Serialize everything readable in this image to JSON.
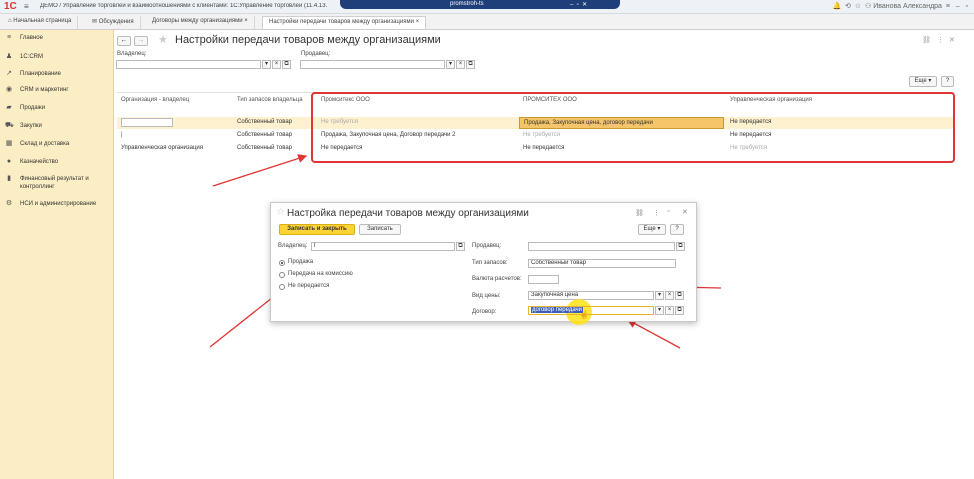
{
  "titlebar": {
    "logo": "1С",
    "title": "ДЕМО / Управление торговлей и взаимоотношениями с клиентами: 1С:Управление торговлей (11.4.13.",
    "overlay_text": "promstroh-ts",
    "user": "Иванова Александра"
  },
  "tabs": [
    {
      "label": "Начальная страница"
    },
    {
      "label": "Обсуждения"
    },
    {
      "label": "Договоры между организациями ×"
    },
    {
      "label": "Настройки передачи товаров между организациями ×"
    }
  ],
  "sidebar": {
    "items": [
      {
        "label": "Главное",
        "icon": "menu-icon"
      },
      {
        "label": "1С:CRM",
        "icon": "users-icon"
      },
      {
        "label": "Планирование",
        "icon": "chart-icon"
      },
      {
        "label": "CRM и маркетинг",
        "icon": "target-icon"
      },
      {
        "label": "Продажи",
        "icon": "bag-icon"
      },
      {
        "label": "Закупки",
        "icon": "cart-icon"
      },
      {
        "label": "Склад и доставка",
        "icon": "warehouse-icon"
      },
      {
        "label": "Казначейство",
        "icon": "coin-icon"
      },
      {
        "label": "Финансовый результат и контроллинг",
        "icon": "bar-chart-icon"
      },
      {
        "label": "НСИ и администрирование",
        "icon": "gear-icon"
      }
    ]
  },
  "page": {
    "title": "Настройки передачи товаров между организациями",
    "owner_label": "Владелец:",
    "owner_value": "",
    "seller_label": "Продавец:",
    "seller_value": "",
    "more_button": "Еще",
    "help_button": "?"
  },
  "grid": {
    "columns": [
      "Организация - владелец",
      "Тип запасов владельца",
      "Промситекс ООО",
      "ПРОМСИТЕХ ООО",
      "Управленческая организация"
    ],
    "rows": [
      [
        "",
        "Собственный товар",
        "Не требуется",
        "Продажа, Закупочная цена, договор передачи",
        "Не передается"
      ],
      [
        "",
        "Собственный товар",
        "Продажа, Закупочная цена, Договор передачи 2",
        "Не требуется",
        "Не передается"
      ],
      [
        "Управленческая организация",
        "Собственный товар",
        "Не передается",
        "Не передается",
        "Не требуется"
      ]
    ]
  },
  "dialog": {
    "title": "Настройка передачи товаров между организациями",
    "save_close_button": "Записать и закрыть",
    "save_button": "Записать",
    "more_button": "Еще",
    "help_button": "?",
    "owner_label": "Владелец:",
    "owner_value": "Г",
    "radio_options": [
      "Продажа",
      "Передача на комиссию",
      "Не передается"
    ],
    "seller_label": "Продавец:",
    "seller_value": "",
    "stock_type_label": "Тип запасов:",
    "stock_type_value": "Собственный товар",
    "currency_label": "Валюта расчетов:",
    "currency_value": "",
    "price_type_label": "Вид цены:",
    "price_type_value": "Закупочная цена",
    "contract_label": "Договор:",
    "contract_value": "договор передачи"
  },
  "colors": {
    "sidebar": "#fbeec4",
    "accent_button": "#fcd334",
    "annotation_red": "#e03535",
    "selected_row": "#fdf1cf"
  }
}
